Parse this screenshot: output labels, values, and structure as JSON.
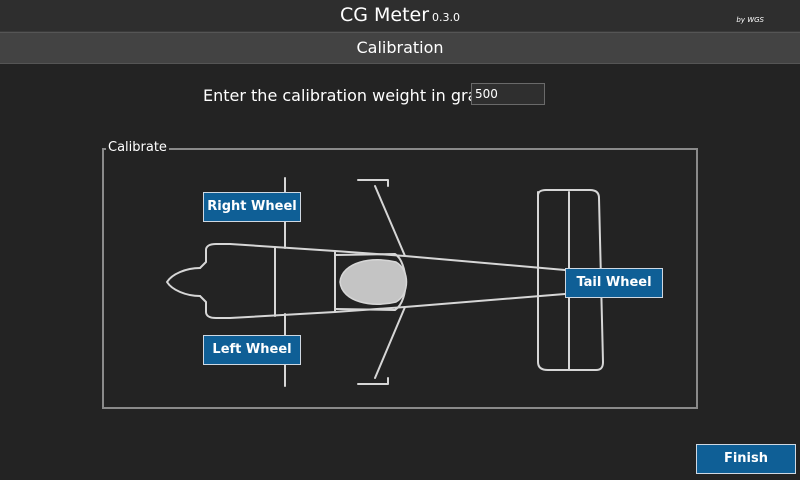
{
  "header": {
    "app_name": "CG Meter",
    "version": "0.3.0",
    "byline": "by WGS"
  },
  "subheader": {
    "title": "Calibration"
  },
  "calibration": {
    "weight_label": "Enter the calibration weight in grams :",
    "weight_value": "500"
  },
  "calibrate_group": {
    "legend": "Calibrate",
    "buttons": {
      "right_wheel": "Right Wheel",
      "left_wheel": "Left Wheel",
      "tail_wheel": "Tail Wheel"
    }
  },
  "footer": {
    "finish_label": "Finish"
  },
  "colors": {
    "background": "#232323",
    "titlebar": "#2e2e2e",
    "subheader": "#434343",
    "button": "#0f5f96",
    "button_border": "#cfd8e2",
    "outline": "#8a8a8a"
  }
}
